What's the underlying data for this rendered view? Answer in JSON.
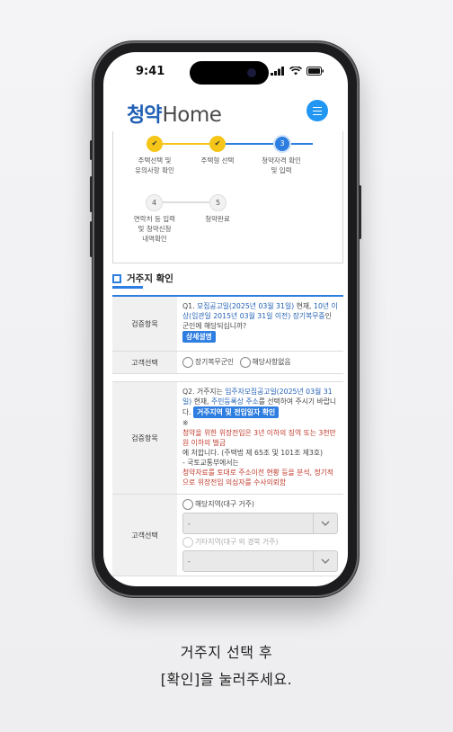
{
  "status": {
    "time": "9:41"
  },
  "header": {
    "logo_prefix": "청약",
    "logo_suffix": "Home",
    "menu_icon": "hamburger-icon"
  },
  "steps": [
    {
      "number": "1",
      "state": "done",
      "label": "주택선택 및\n유의사항 확인"
    },
    {
      "number": "2",
      "state": "done",
      "label": "주택형 선택"
    },
    {
      "number": "3",
      "state": "current",
      "label": "청약자격 확인\n및 입력"
    },
    {
      "number": "4",
      "state": "todo",
      "label": "연락처 등 입력\n및 청약신청\n내역확인"
    },
    {
      "number": "5",
      "state": "todo",
      "label": "청약완료"
    }
  ],
  "section": {
    "title": "거주지 확인"
  },
  "q1": {
    "head": "검증항목",
    "text_a": "Q1. ",
    "text_b": "모집공고일(2025년 03월 31일)",
    "text_c": " 현재, ",
    "text_d": "10년 이상(임관일 2015년 03월 31일 이전) 장기복무중",
    "text_e": "인 군인에 해당되십니까?",
    "badge": "상세설명"
  },
  "q1_choice": {
    "head": "고객선택",
    "option1": "장기복무군인",
    "option2": "해당사항없음"
  },
  "q2": {
    "head": "검증항목",
    "text_a": "Q2. 거주지는 ",
    "text_b": "입주자모집공고일(2025년 03월 31일)",
    "text_c": " 현재, ",
    "text_d": "주민등록상 주소",
    "text_e": "를 선택하여 주시기 바랍니다.",
    "badge": "거주지역 및 전입일자 확인",
    "note_mark": "※",
    "warn1": "청약을 위한 위장전입은 3년 이하의 징역 또는 3천만원 이하의 벌금",
    "note1": "에 처합니다. (주택법 제 65조 및 101조 제3호)",
    "note2": "- 국토교통부에서는",
    "warn2": "청약자료를 토대로 주소이전 현황 등을 분석, 정기적으로 위장전입 의심자를 수사의뢰함"
  },
  "q2_choice": {
    "head": "고객선택",
    "option1": "해당지역(대구 거주)",
    "select1": "-",
    "option2": "기타지역(대구 외 경북 거주)",
    "select2": "-"
  },
  "caption": {
    "line1": "거주지 선택 후",
    "line2": "[확인]을 눌러주세요."
  },
  "colors": {
    "accent": "#2e7de0",
    "done": "#f5c518",
    "warning": "#c0392b"
  }
}
